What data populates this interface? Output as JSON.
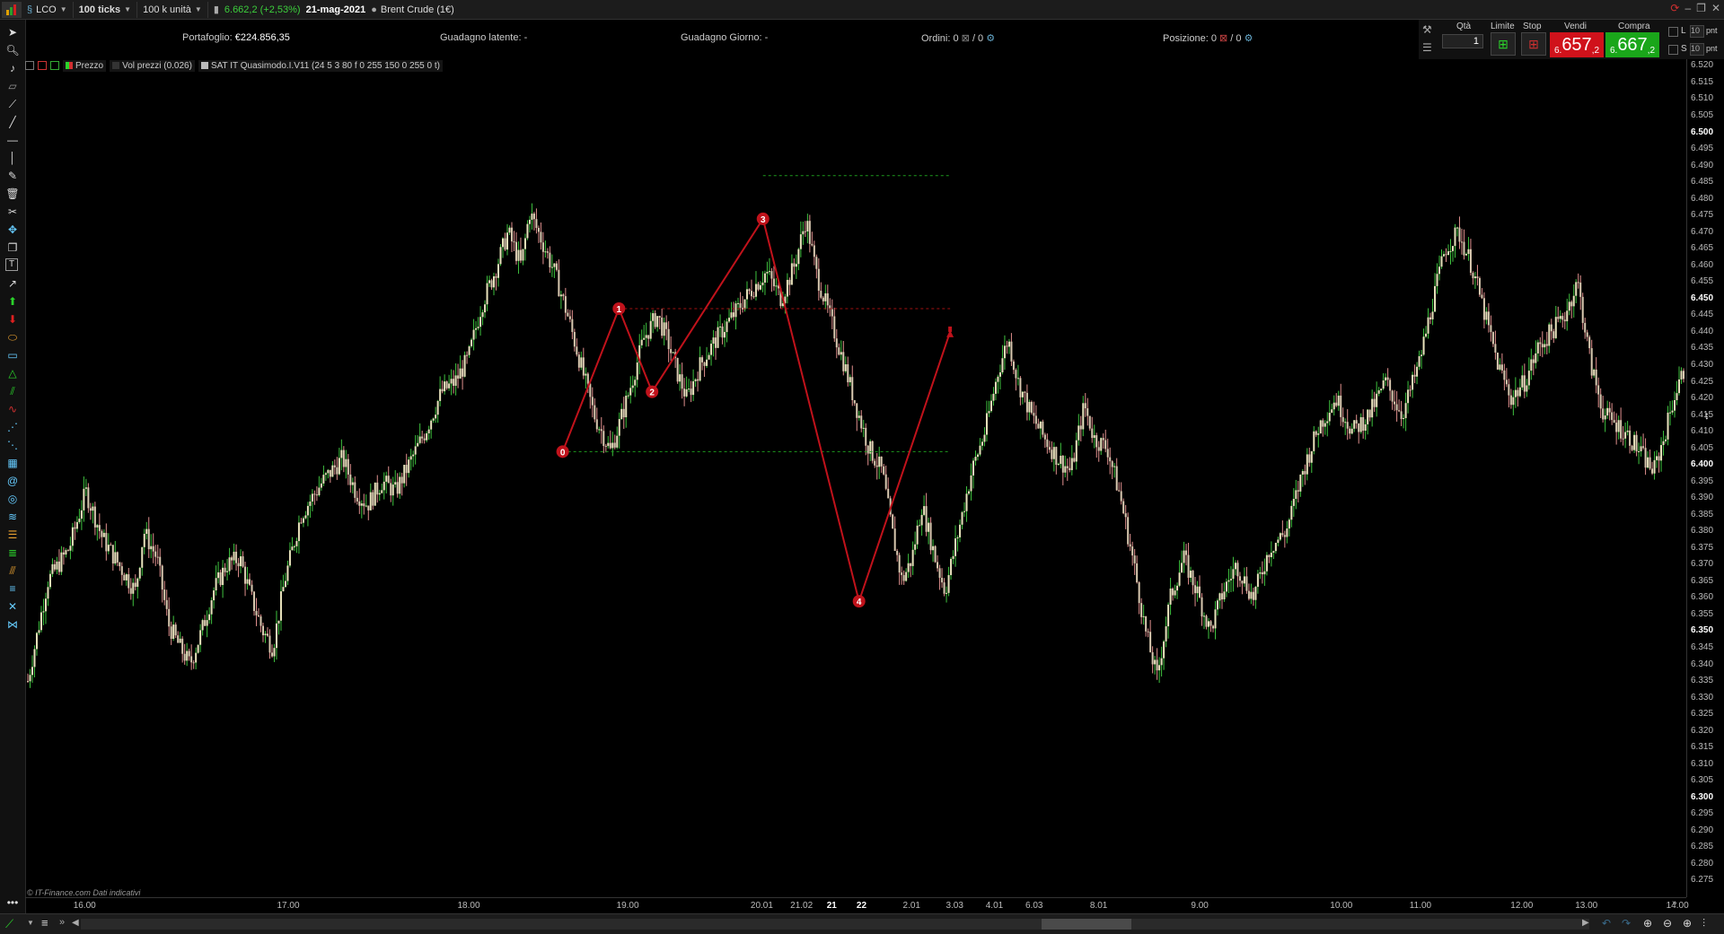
{
  "topbar": {
    "symbol": "LCO",
    "timeframe": "100 ticks",
    "units": "100 k unità",
    "quote": "6.662,2 (+2,53%)",
    "date": "21-mag-2021",
    "instrument": "Brent Crude (1€)"
  },
  "portfolio": {
    "portafoglio_label": "Portafoglio:",
    "portafoglio_value": "€224.856,35",
    "guadagno_latente_label": "Guadagno latente:",
    "guadagno_latente_value": "-",
    "guadagno_giorno_label": "Guadagno Giorno:",
    "guadagno_giorno_value": "-",
    "ordini_label": "Ordini:",
    "ordini_value_a": "0",
    "ordini_value_b": "/ 0",
    "posizione_label": "Posizione:",
    "posizione_value_a": "0",
    "posizione_value_b": "/ 0"
  },
  "order_panel": {
    "qty_label": "Qtà",
    "qty_value": "1",
    "limite_label": "Limite",
    "stop_label": "Stop",
    "vendi_label": "Vendi",
    "compra_label": "Compra",
    "vendi_prefix": "6.",
    "vendi_price": "657",
    "vendi_suffix": ",2",
    "compra_prefix": "6.",
    "compra_price": "667",
    "compra_suffix": ",2",
    "l_label": "L",
    "s_label": "S",
    "pnt_label": "pnt",
    "l_value": "10",
    "s_value": "10",
    "colors": {
      "sell": "#d0121b",
      "buy": "#1aa61a"
    }
  },
  "legend": {
    "price": "Prezzo",
    "volume": "Vol prezzi (0.026)",
    "indicator": "SAT IT Quasimodo.I.V11 (24 5 3 80 f 0 255 150 0 255 0 t)"
  },
  "copyright": "© IT-Finance.com Dati indicativi",
  "tools": [
    "cursor-arrow-icon",
    "zoom-icon",
    "alarm-bell-icon",
    "ruler-icon",
    "segment-icon",
    "trend-line-icon",
    "horizontal-line-icon",
    "vertical-line-icon",
    "pencil-icon",
    "trash-icon",
    "tools-icon",
    "move-icon",
    "copy-icon",
    "text-icon",
    "arrow-line-icon",
    "arrow-up-green-icon",
    "arrow-down-red-icon",
    "ellipse-icon",
    "rectangle-icon",
    "triangle-icon",
    "channel-icon",
    "wave-icon",
    "pattern-1-icon",
    "pattern-2-icon",
    "pattern-3-icon",
    "spiral-icon",
    "fibonacci-icon",
    "fib-fan-icon",
    "fib-time-icon",
    "gann-icon",
    "andrews-icon",
    "elliott-icon",
    "harmonic-icon",
    "more-icon"
  ],
  "chart_data": {
    "type": "candlestick",
    "y_ticks": [
      "6.520",
      "6.515",
      "6.510",
      "6.505",
      "6.500",
      "6.495",
      "6.490",
      "6.485",
      "6.480",
      "6.475",
      "6.470",
      "6.465",
      "6.460",
      "6.455",
      "6.450",
      "6.445",
      "6.440",
      "6.435",
      "6.430",
      "6.425",
      "6.420",
      "6.415",
      "6.410",
      "6.405",
      "6.400",
      "6.395",
      "6.390",
      "6.385",
      "6.380",
      "6.375",
      "6.370",
      "6.365",
      "6.360",
      "6.355",
      "6.350",
      "6.345",
      "6.340",
      "6.335",
      "6.330",
      "6.325",
      "6.320",
      "6.315",
      "6.310",
      "6.305",
      "6.300",
      "6.295",
      "6.290",
      "6.285",
      "6.280",
      "6.275"
    ],
    "y_major": [
      "6.500",
      "6.450",
      "6.400",
      "6.350",
      "6.300"
    ],
    "ylim": [
      6.27,
      6.522
    ],
    "x_ticks": [
      {
        "label": "16.00",
        "t": 0.034
      },
      {
        "label": "17.00",
        "t": 0.157
      },
      {
        "label": "18.00",
        "t": 0.266
      },
      {
        "label": "19.00",
        "t": 0.362
      },
      {
        "label": "20.01",
        "t": 0.443
      },
      {
        "label": "21.02",
        "t": 0.467
      },
      {
        "label": "21",
        "t": 0.489,
        "major": true
      },
      {
        "label": "22",
        "t": 0.507,
        "major": true
      },
      {
        "label": "2.01",
        "t": 0.535
      },
      {
        "label": "3.03",
        "t": 0.561
      },
      {
        "label": "4.01",
        "t": 0.585
      },
      {
        "label": "6.03",
        "t": 0.609
      },
      {
        "label": "8.01",
        "t": 0.648
      },
      {
        "label": "9.00",
        "t": 0.709
      },
      {
        "label": "10.00",
        "t": 0.793
      },
      {
        "label": "11.00",
        "t": 0.841
      },
      {
        "label": "12.00",
        "t": 0.902
      },
      {
        "label": "13.00",
        "t": 0.941
      },
      {
        "label": "14.00",
        "t": 0.996
      }
    ],
    "price_path": [
      [
        0.0,
        6.335
      ],
      [
        0.012,
        6.365
      ],
      [
        0.025,
        6.375
      ],
      [
        0.035,
        6.392
      ],
      [
        0.045,
        6.378
      ],
      [
        0.055,
        6.37
      ],
      [
        0.065,
        6.362
      ],
      [
        0.07,
        6.38
      ],
      [
        0.078,
        6.372
      ],
      [
        0.085,
        6.352
      ],
      [
        0.092,
        6.345
      ],
      [
        0.098,
        6.34
      ],
      [
        0.105,
        6.35
      ],
      [
        0.112,
        6.362
      ],
      [
        0.12,
        6.37
      ],
      [
        0.128,
        6.372
      ],
      [
        0.135,
        6.36
      ],
      [
        0.142,
        6.35
      ],
      [
        0.148,
        6.345
      ],
      [
        0.155,
        6.365
      ],
      [
        0.165,
        6.385
      ],
      [
        0.178,
        6.395
      ],
      [
        0.19,
        6.402
      ],
      [
        0.198,
        6.392
      ],
      [
        0.205,
        6.388
      ],
      [
        0.214,
        6.395
      ],
      [
        0.222,
        6.392
      ],
      [
        0.23,
        6.4
      ],
      [
        0.24,
        6.41
      ],
      [
        0.25,
        6.422
      ],
      [
        0.258,
        6.425
      ],
      [
        0.266,
        6.432
      ],
      [
        0.274,
        6.448
      ],
      [
        0.282,
        6.458
      ],
      [
        0.29,
        6.47
      ],
      [
        0.298,
        6.46
      ],
      [
        0.303,
        6.476
      ],
      [
        0.31,
        6.468
      ],
      [
        0.318,
        6.458
      ],
      [
        0.326,
        6.445
      ],
      [
        0.334,
        6.43
      ],
      [
        0.342,
        6.415
      ],
      [
        0.352,
        6.404
      ],
      [
        0.362,
        6.42
      ],
      [
        0.372,
        6.438
      ],
      [
        0.38,
        6.445
      ],
      [
        0.386,
        6.438
      ],
      [
        0.392,
        6.428
      ],
      [
        0.398,
        6.42
      ],
      [
        0.406,
        6.43
      ],
      [
        0.416,
        6.438
      ],
      [
        0.426,
        6.445
      ],
      [
        0.436,
        6.452
      ],
      [
        0.446,
        6.458
      ],
      [
        0.455,
        6.45
      ],
      [
        0.463,
        6.46
      ],
      [
        0.47,
        6.474
      ],
      [
        0.476,
        6.458
      ],
      [
        0.484,
        6.445
      ],
      [
        0.492,
        6.432
      ],
      [
        0.5,
        6.418
      ],
      [
        0.508,
        6.405
      ],
      [
        0.516,
        6.398
      ],
      [
        0.522,
        6.38
      ],
      [
        0.528,
        6.365
      ],
      [
        0.534,
        6.372
      ],
      [
        0.54,
        6.388
      ],
      [
        0.548,
        6.372
      ],
      [
        0.554,
        6.362
      ],
      [
        0.562,
        6.38
      ],
      [
        0.57,
        6.398
      ],
      [
        0.578,
        6.41
      ],
      [
        0.586,
        6.428
      ],
      [
        0.592,
        6.438
      ],
      [
        0.598,
        6.425
      ],
      [
        0.606,
        6.415
      ],
      [
        0.614,
        6.408
      ],
      [
        0.622,
        6.402
      ],
      [
        0.63,
        6.398
      ],
      [
        0.638,
        6.418
      ],
      [
        0.644,
        6.408
      ],
      [
        0.652,
        6.405
      ],
      [
        0.66,
        6.39
      ],
      [
        0.668,
        6.37
      ],
      [
        0.675,
        6.35
      ],
      [
        0.682,
        6.336
      ],
      [
        0.69,
        6.36
      ],
      [
        0.698,
        6.372
      ],
      [
        0.706,
        6.362
      ],
      [
        0.714,
        6.35
      ],
      [
        0.722,
        6.362
      ],
      [
        0.73,
        6.37
      ],
      [
        0.74,
        6.36
      ],
      [
        0.75,
        6.375
      ],
      [
        0.76,
        6.38
      ],
      [
        0.77,
        6.398
      ],
      [
        0.78,
        6.412
      ],
      [
        0.79,
        6.42
      ],
      [
        0.8,
        6.41
      ],
      [
        0.81,
        6.415
      ],
      [
        0.82,
        6.425
      ],
      [
        0.83,
        6.415
      ],
      [
        0.84,
        6.43
      ],
      [
        0.848,
        6.448
      ],
      [
        0.856,
        6.465
      ],
      [
        0.864,
        6.47
      ],
      [
        0.872,
        6.46
      ],
      [
        0.88,
        6.445
      ],
      [
        0.888,
        6.43
      ],
      [
        0.896,
        6.42
      ],
      [
        0.904,
        6.425
      ],
      [
        0.912,
        6.435
      ],
      [
        0.92,
        6.44
      ],
      [
        0.928,
        6.445
      ],
      [
        0.936,
        6.455
      ],
      [
        0.944,
        6.43
      ],
      [
        0.952,
        6.415
      ],
      [
        0.96,
        6.412
      ],
      [
        0.968,
        6.408
      ],
      [
        0.976,
        6.402
      ],
      [
        0.982,
        6.398
      ],
      [
        0.988,
        6.408
      ],
      [
        0.994,
        6.42
      ],
      [
        1.0,
        6.428
      ]
    ],
    "pattern": {
      "name": "Quasimodo",
      "pivots": [
        {
          "label": "0",
          "t": 0.323,
          "y": 6.404
        },
        {
          "label": "1",
          "t": 0.357,
          "y": 6.447
        },
        {
          "label": "2",
          "t": 0.377,
          "y": 6.422
        },
        {
          "label": "3",
          "t": 0.444,
          "y": 6.474
        },
        {
          "label": "4",
          "t": 0.502,
          "y": 6.359
        },
        {
          "label": "5",
          "t": 0.557,
          "y": 6.44
        }
      ],
      "levels": [
        {
          "y": 6.487,
          "t0": 0.444,
          "t1": 0.557,
          "color": "#1e9a1e"
        },
        {
          "y": 6.447,
          "t0": 0.357,
          "t1": 0.557,
          "color": "#a01010"
        },
        {
          "y": 6.404,
          "t0": 0.323,
          "t1": 0.557,
          "color": "#1e9a1e"
        }
      ],
      "color": "#c0121b"
    }
  }
}
